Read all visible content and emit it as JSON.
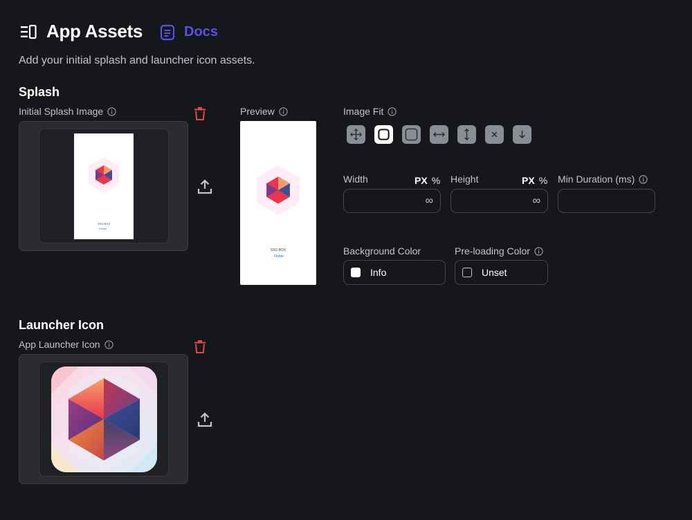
{
  "header": {
    "title": "App Assets",
    "docs_label": "Docs",
    "subtitle": "Add your initial splash and launcher icon assets."
  },
  "splash": {
    "section_title": "Splash",
    "image_label": "Initial Splash Image",
    "preview_label": "Preview",
    "image_fit_label": "Image Fit",
    "image_fit_options": [
      "fill-icon",
      "contain-icon",
      "cover-icon",
      "fit-width-icon",
      "fit-height-icon",
      "none-icon",
      "scale-down-icon"
    ],
    "image_fit_selected": "contain-icon",
    "width": {
      "label": "Width",
      "unit_px": "PX",
      "unit_pct": "%",
      "value": "∞"
    },
    "height": {
      "label": "Height",
      "unit_px": "PX",
      "unit_pct": "%",
      "value": "∞"
    },
    "min_duration": {
      "label": "Min Duration (ms)",
      "value": ""
    },
    "background_color": {
      "label": "Background Color",
      "value": "Info",
      "swatch": "#ffffff"
    },
    "preloading_color": {
      "label": "Pre-loading Color",
      "value": "Unset"
    },
    "thumb_caption": "SSG BOX",
    "thumb_brand": "Flutter"
  },
  "launcher": {
    "section_title": "Launcher Icon",
    "icon_label": "App Launcher Icon"
  },
  "colors": {
    "background": "#16171b",
    "accent": "#5a51e8",
    "danger": "#e5484d",
    "panel": "#2a2c31"
  }
}
